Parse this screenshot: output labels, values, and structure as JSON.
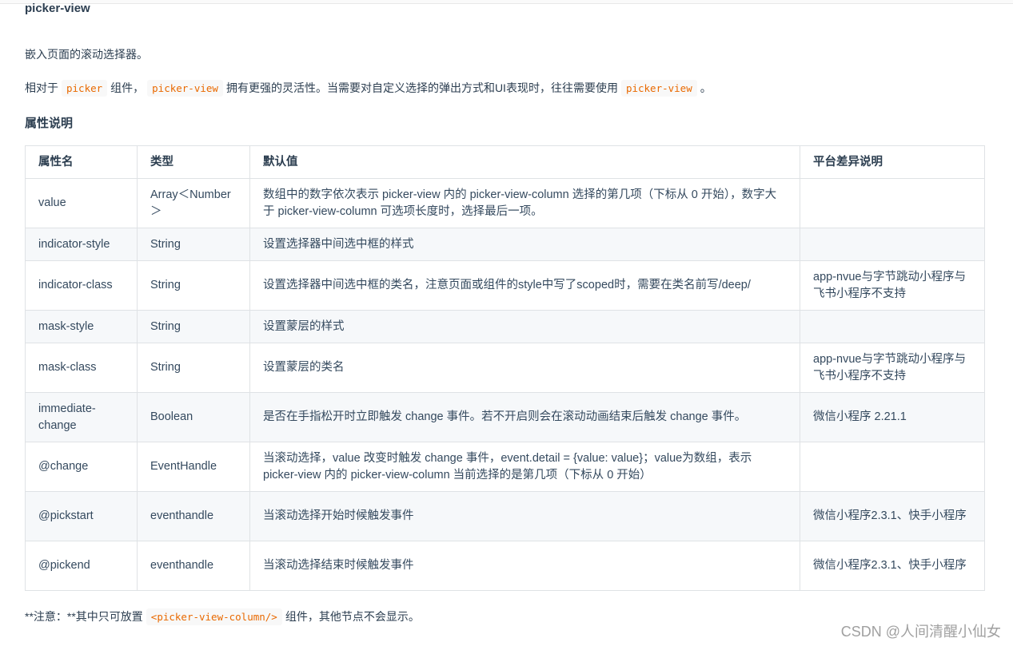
{
  "title": "picker-view",
  "intro": "嵌入页面的滚动选择器。",
  "desc": {
    "part1": "相对于",
    "code1": "picker",
    "part2": "组件，",
    "code2": "picker-view",
    "part3": "拥有更强的灵活性。当需要对自定义选择的弹出方式和UI表现时，往往需要使用",
    "code3": "picker-view",
    "part4": "。"
  },
  "section_title": "属性说明",
  "table": {
    "headers": [
      "属性名",
      "类型",
      "默认值",
      "平台差异说明"
    ],
    "rows": [
      [
        "value",
        "Array＜Number＞",
        "数组中的数字依次表示 picker-view 内的 picker-view-column 选择的第几项（下标从 0 开始），数字大于 picker-view-column 可选项长度时，选择最后一项。",
        ""
      ],
      [
        "indicator-style",
        "String",
        "设置选择器中间选中框的样式",
        ""
      ],
      [
        "indicator-class",
        "String",
        "设置选择器中间选中框的类名，注意页面或组件的style中写了scoped时，需要在类名前写/deep/",
        "app-nvue与字节跳动小程序与飞书小程序不支持"
      ],
      [
        "mask-style",
        "String",
        "设置蒙层的样式",
        ""
      ],
      [
        "mask-class",
        "String",
        "设置蒙层的类名",
        "app-nvue与字节跳动小程序与飞书小程序不支持"
      ],
      [
        "immediate-change",
        "Boolean",
        "是否在手指松开时立即触发 change 事件。若不开启则会在滚动动画结束后触发 change 事件。",
        "微信小程序 2.21.1"
      ],
      [
        "@change",
        "EventHandle",
        "当滚动选择，value 改变时触发 change 事件，event.detail = {value: value}；value为数组，表示 picker-view 内的 picker-view-column 当前选择的是第几项（下标从 0 开始）",
        ""
      ],
      [
        "@pickstart",
        "eventhandle",
        "当滚动选择开始时候触发事件",
        "微信小程序2.3.1、快手小程序"
      ],
      [
        "@pickend",
        "eventhandle",
        "当滚动选择结束时候触发事件",
        "微信小程序2.3.1、快手小程序"
      ]
    ]
  },
  "note": {
    "part1": "**注意：**其中只可放置",
    "code": "<picker-view-column/>",
    "part2": "组件，其他节点不会显示。"
  },
  "watermark": "CSDN @人间清醒小仙女"
}
